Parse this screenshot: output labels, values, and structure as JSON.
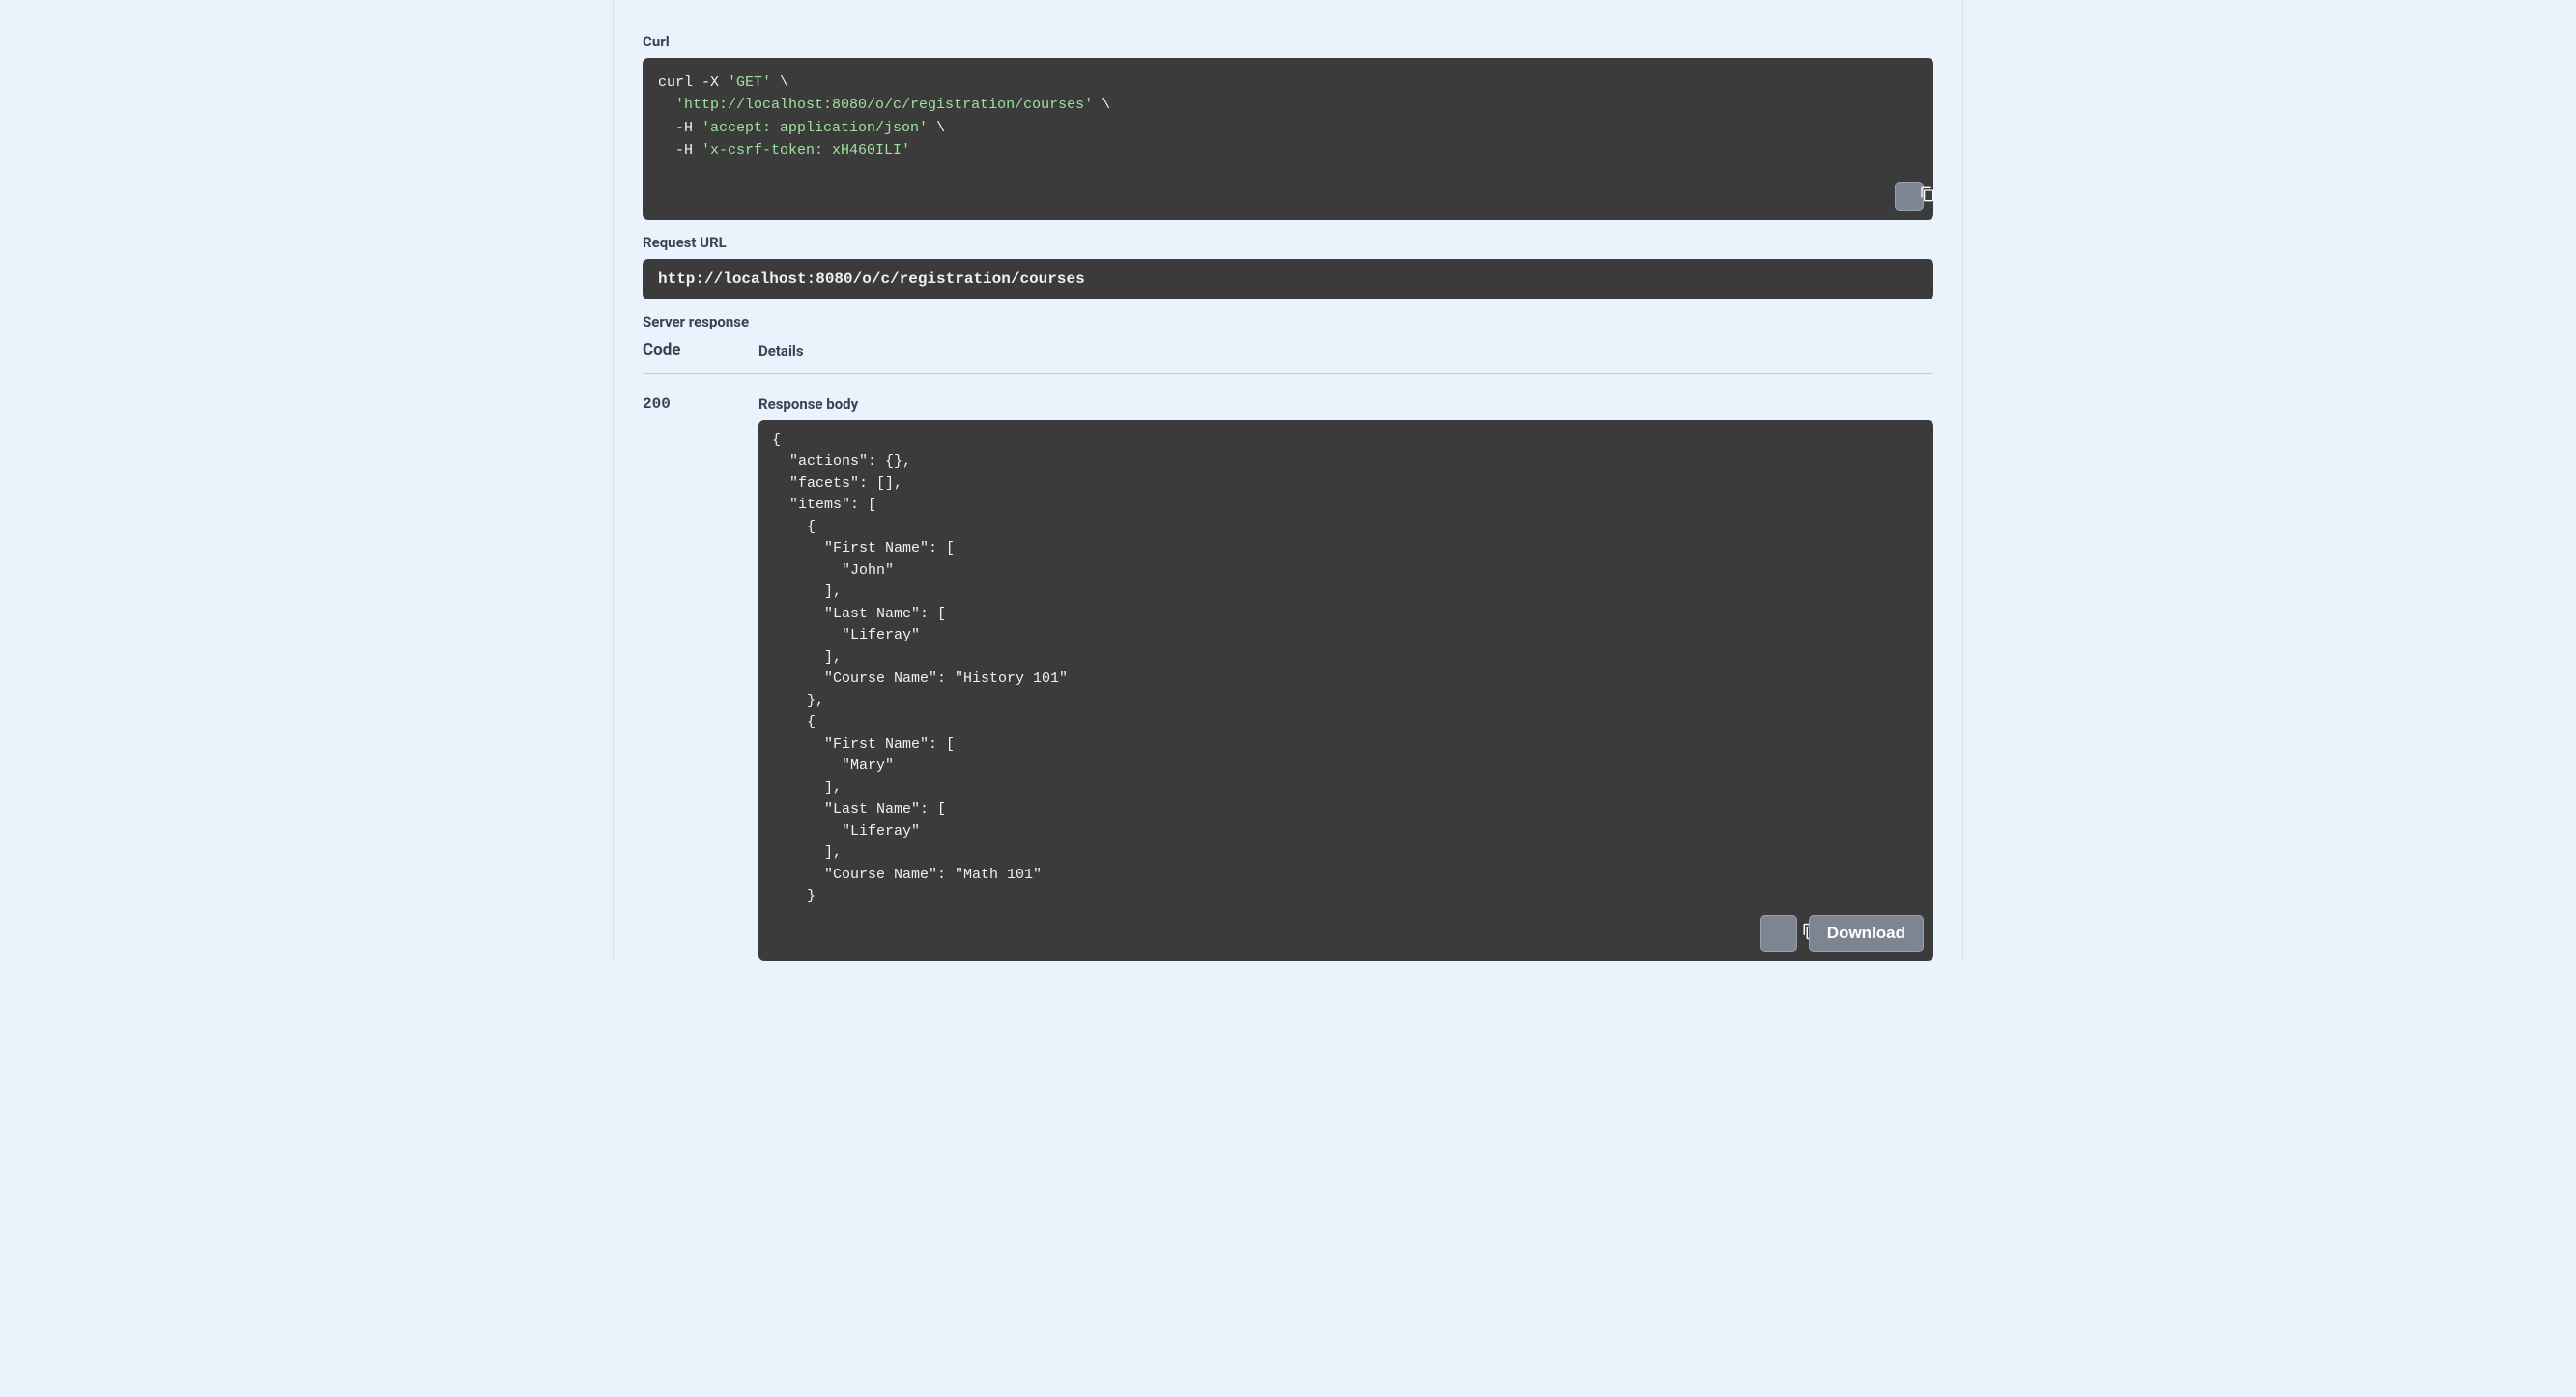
{
  "labels": {
    "curl": "Curl",
    "request_url": "Request URL",
    "server_response": "Server response",
    "code_header": "Code",
    "details_header": "Details",
    "response_body": "Response body",
    "download": "Download"
  },
  "curl": {
    "prefix": "curl -X ",
    "method": "'GET'",
    "cont": " \\",
    "line2_str": "'http://localhost:8080/o/c/registration/courses'",
    "line2_cont": " \\",
    "line3_prefix": "  -H ",
    "line3_str": "'accept: application/json'",
    "line3_cont": " \\",
    "line4_prefix": "  -H ",
    "line4_str": "'x-csrf-token: xH460ILI'"
  },
  "request_url": "http://localhost:8080/o/c/registration/courses",
  "response": {
    "code": "200",
    "body_lines": [
      {
        "t": "plain",
        "v": "{"
      },
      {
        "t": "plain",
        "v": "  \"actions\": {},"
      },
      {
        "t": "plain",
        "v": "  \"facets\": [],"
      },
      {
        "t": "plain",
        "v": "  \"items\": ["
      },
      {
        "t": "plain",
        "v": "    {"
      },
      {
        "t": "plain",
        "v": "      \"First Name\": ["
      },
      {
        "t": "str",
        "v": "        \"John\""
      },
      {
        "t": "plain",
        "v": "      ],"
      },
      {
        "t": "plain",
        "v": "      \"Last Name\": ["
      },
      {
        "t": "str",
        "v": "        \"Liferay\""
      },
      {
        "t": "plain",
        "v": "      ],"
      },
      {
        "t": "kv",
        "k": "      \"Course Name\": ",
        "v": "\"History 101\""
      },
      {
        "t": "plain",
        "v": "    },"
      },
      {
        "t": "plain",
        "v": "    {"
      },
      {
        "t": "plain",
        "v": "      \"First Name\": ["
      },
      {
        "t": "str",
        "v": "        \"Mary\""
      },
      {
        "t": "plain",
        "v": "      ],"
      },
      {
        "t": "plain",
        "v": "      \"Last Name\": ["
      },
      {
        "t": "str",
        "v": "        \"Liferay\""
      },
      {
        "t": "plain",
        "v": "      ],"
      },
      {
        "t": "kv",
        "k": "      \"Course Name\": ",
        "v": "\"Math 101\""
      },
      {
        "t": "plain",
        "v": "    }"
      }
    ]
  }
}
